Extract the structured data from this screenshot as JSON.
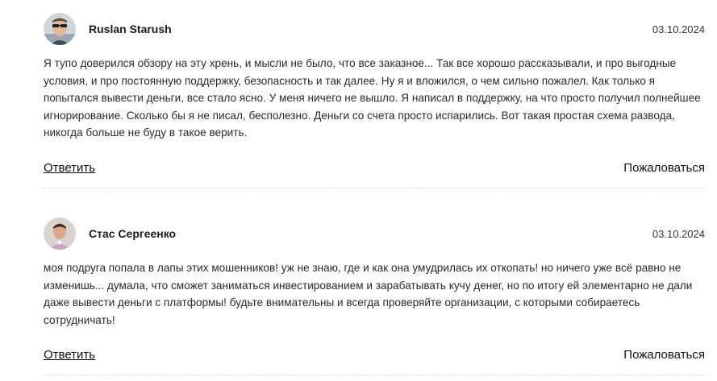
{
  "comments": [
    {
      "author": "Ruslan Starush",
      "date": "03.10.2024",
      "text": "Я тупо доверился обзору на эту хрень, и мысли не было, что все заказное... Так все хорошо рассказывали, и про выгодные условия, и про постоянную поддержку, безопасность и так далее. Ну я и вложился, о чем сильно пожалел. Как только я попытался вывести деньги, все стало ясно. У меня ничего не вышло. Я написал в поддержку, на что просто получил полнейшее игнорирование. Сколько бы я не писал, бесполезно. Деньги со счета просто испарились. Вот такая простая схема развода, никогда больше не буду в такое верить.",
      "reply_label": "Ответить",
      "report_label": "Пожаловаться"
    },
    {
      "author": "Стас Сергеенко",
      "date": "03.10.2024",
      "text": "моя подруга попала в лапы этих мошенников! уж не знаю, где и как она умудрилась их откопать! но ничего уже всё равно не изменишь... думала, что сможет заниматься инвестированием и зарабатывать кучу денег, но по итогу ей элементарно не дали даже вывести деньги с платформы! будьте внимательны и всегда проверяйте организации, с которыми собираетесь сотрудничать!",
      "reply_label": "Ответить",
      "report_label": "Пожаловаться"
    }
  ],
  "colors": {
    "text": "#2a2a2a",
    "divider": "#dcdcdc",
    "background": "#ffffff"
  }
}
